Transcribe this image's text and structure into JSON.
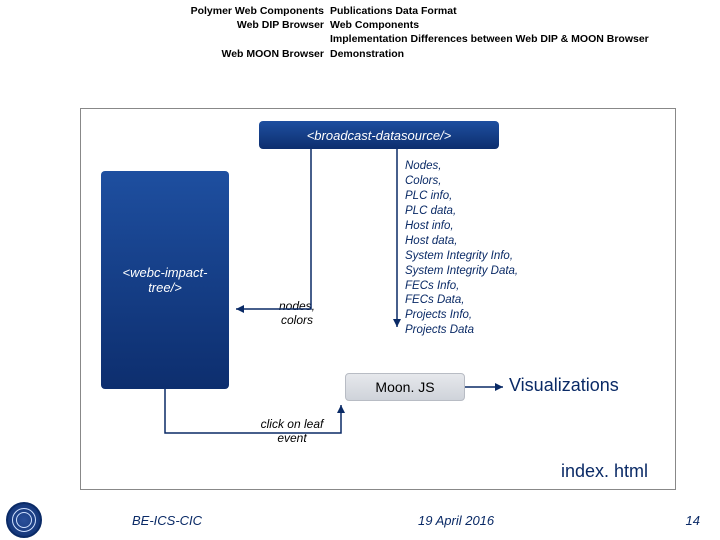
{
  "header": {
    "rows": [
      {
        "left": "Polymer Web Components",
        "right": "Publications Data Format"
      },
      {
        "left": "Web DIP Browser",
        "right": "Web Components"
      },
      {
        "left": "",
        "right": "Implementation Differences between Web DIP & MOON Browser"
      },
      {
        "left": "Web MOON Browser",
        "right": "Demonstration"
      }
    ]
  },
  "diagram": {
    "broadcast": "<broadcast-datasource/>",
    "tree": "<webc-impact-tree/>",
    "moonjs": "Moon. JS",
    "nodes_colors": "nodes,\ncolors",
    "click_leaf": "click on\nleaf\nevent",
    "data_list": "Nodes,\nColors,\nPLC info,\nPLC data,\nHost info,\nHost data,\nSystem Integrity Info,\nSystem Integrity Data,\nFECs Info,\nFECs Data,\nProjects Info,\nProjects Data",
    "visualizations": "Visualizations",
    "indexhtml": "index. html"
  },
  "footer": {
    "org": "BE-ICS-CIC",
    "date": "19 April 2016",
    "page": "14"
  }
}
